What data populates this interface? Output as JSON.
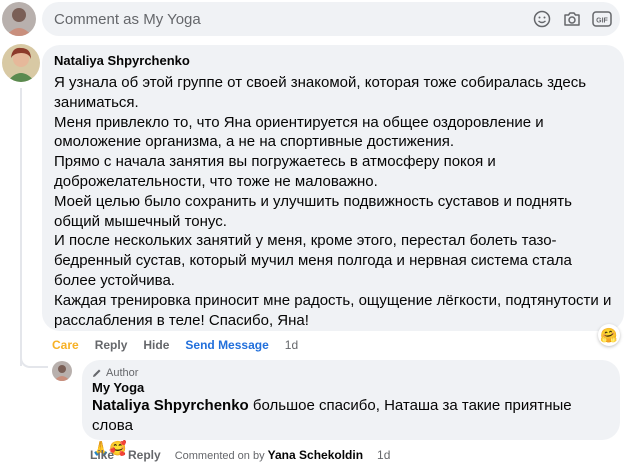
{
  "composer": {
    "placeholder": "Comment as My Yoga",
    "icons": [
      "emoji-icon",
      "camera-icon",
      "gif-icon"
    ],
    "gif_label": "GIF"
  },
  "comment": {
    "author": "Nataliya Shpyrchenko",
    "paragraphs": [
      "Я узнала об этой группе от своей знакомой, которая тоже собиралась здесь заниматься.",
      "Меня привлекло то, что Яна ориентируется на общее оздоровление и омоложение организма, а не на спортивные достижения.",
      "Прямо с начала занятия вы погружаетесь в атмосферу покоя и доброжелательности, что тоже не маловажно.",
      "Моей целью было сохранить и улучшить подвижность суставов и поднять общий мышечный тонус.",
      "И после нескольких занятий у меня, кроме этого, перестал болеть тазо-бедренный сустав, который мучил меня полгода и нервная система стала более устойчива.",
      "Каждая тренировка приносит мне радость, ощущение лёгкости, подтянутости и расслабления в теле! Спасибо, Яна!"
    ],
    "reaction_emoji": "🤗",
    "actions": {
      "care": "Care",
      "reply": "Reply",
      "hide": "Hide",
      "send_message": "Send Message",
      "time": "1d"
    }
  },
  "reply": {
    "badge": "Author",
    "page": "My Yoga",
    "mention": "Nataliya Shpyrchenko",
    "text": " большое спасибо, Наташа за такие приятные слова",
    "emojis": "🙏🥰",
    "actions": {
      "like": "Like",
      "reply": "Reply",
      "commented_on_by": "Commented on by",
      "commenter": "Yana Schekoldin",
      "time": "1d"
    }
  },
  "colors": {
    "care": "#f7b125",
    "link": "#216fdb",
    "bubble": "#f0f2f5",
    "muted": "#65676b"
  }
}
